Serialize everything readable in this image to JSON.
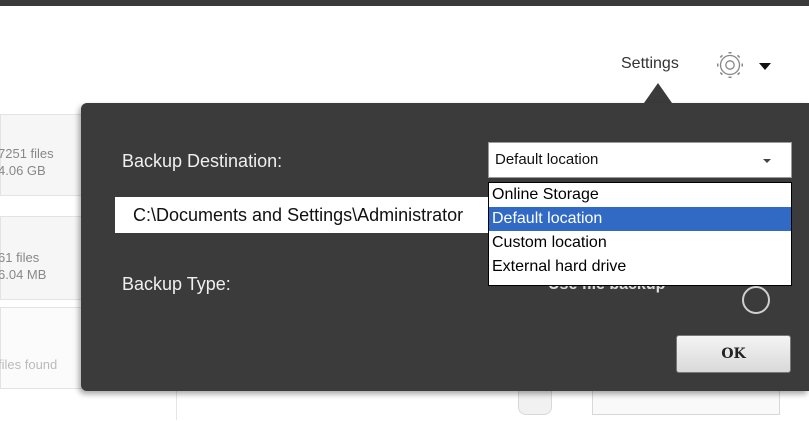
{
  "header": {
    "settings_label": "Settings",
    "gear_icon": "gear-icon",
    "dropdown_icon": "caret-down-icon"
  },
  "background_list": [
    {
      "line1": "7251 files",
      "line2": "4.06 GB"
    },
    {
      "line1": "61 files",
      "line2": "6.04 MB"
    },
    {
      "line1": "files found"
    }
  ],
  "popup": {
    "destination_label": "Backup Destination:",
    "path_value": "C:\\Documents and Settings\\Administrator",
    "destination_select": {
      "selected": "Default location",
      "options": [
        "Online Storage",
        "Default location",
        "Custom location",
        "External hard drive"
      ],
      "highlighted": "Default location"
    },
    "type_label": "Backup Type:",
    "type_value": "Use file backup",
    "ok_label": "OK"
  },
  "colors": {
    "panel": "#3b3b3b",
    "selection": "#316ac5"
  }
}
